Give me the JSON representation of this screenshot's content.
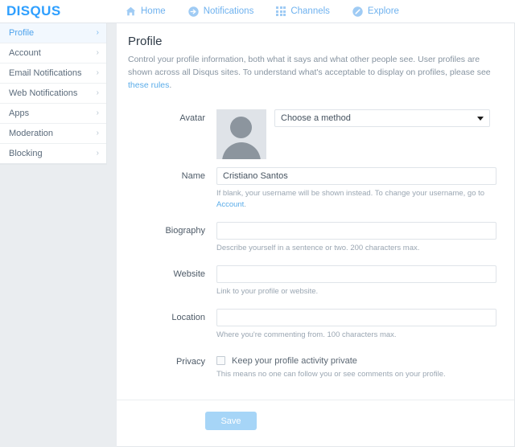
{
  "brand": {
    "logo": "DISQUS"
  },
  "nav": {
    "items": [
      {
        "label": "Home",
        "icon": "home-icon"
      },
      {
        "label": "Notifications",
        "icon": "notifications-icon"
      },
      {
        "label": "Channels",
        "icon": "channels-grid-icon"
      },
      {
        "label": "Explore",
        "icon": "explore-compass-icon"
      }
    ]
  },
  "sidebar": {
    "items": [
      {
        "label": "Profile",
        "active": true
      },
      {
        "label": "Account",
        "active": false
      },
      {
        "label": "Email Notifications",
        "active": false
      },
      {
        "label": "Web Notifications",
        "active": false
      },
      {
        "label": "Apps",
        "active": false
      },
      {
        "label": "Moderation",
        "active": false
      },
      {
        "label": "Blocking",
        "active": false
      }
    ],
    "chevron": "›"
  },
  "main": {
    "title": "Profile",
    "description_part1": "Control your profile information, both what it says and what other people see. User profiles are shown across all Disqus sites. To understand what's acceptable to display on profiles, please see ",
    "description_link": "these rules",
    "description_part2": ".",
    "form": {
      "avatar": {
        "label": "Avatar",
        "method_select_value": "Choose a method"
      },
      "name": {
        "label": "Name",
        "value": "Cristiano Santos",
        "placeholder": "",
        "hint_part1": "If blank, your username will be shown instead. To change your username, go to ",
        "hint_link": "Account",
        "hint_part2": "."
      },
      "biography": {
        "label": "Biography",
        "value": "",
        "placeholder": "",
        "hint": "Describe yourself in a sentence or two. 200 characters max."
      },
      "website": {
        "label": "Website",
        "value": "",
        "placeholder": "",
        "hint": "Link to your profile or website."
      },
      "location": {
        "label": "Location",
        "value": "",
        "placeholder": "",
        "hint": "Where you're commenting from. 100 characters max."
      },
      "privacy": {
        "label": "Privacy",
        "checkbox_label": "Keep your profile activity private",
        "checked": false,
        "hint": "This means no one can follow you or see comments on your profile."
      },
      "save_label": "Save"
    }
  },
  "colors": {
    "brand_blue": "#2e9fff",
    "nav_blue": "#7cb9f0",
    "link_blue": "#5aace9",
    "save_button": "#a6d5f7",
    "page_background": "#eaedf0",
    "active_item_bg": "#f2f8fe"
  }
}
